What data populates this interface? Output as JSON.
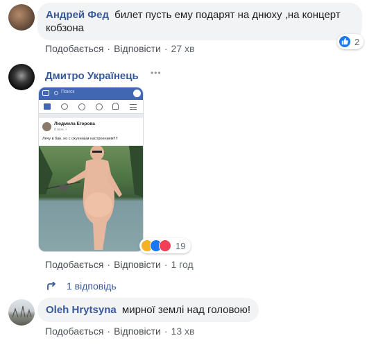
{
  "comments": [
    {
      "author": "Андрей Фед",
      "text": "билет пусть ему подарят на днюху ,на концерт кобзона",
      "actions": {
        "like": "Подобається",
        "reply": "Відповісти",
        "time": "27 хв"
      },
      "reactions": {
        "count": "2"
      }
    },
    {
      "author": "Дмитро Українець",
      "more_icon": "•••",
      "image": {
        "search_placeholder": "Поиск",
        "post_author": "Людмила Егорова",
        "post_meta": "8 июн. •",
        "post_text": "Лечу в бан, но с охуенным настроением!!!!"
      },
      "actions": {
        "like": "Подобається",
        "reply": "Відповісти",
        "time": "1 год"
      },
      "reactions": {
        "count": "19"
      },
      "replies_label": "1 відповідь"
    },
    {
      "author": "Oleh Hrytsyna",
      "text": "мирної землі над головою!",
      "actions": {
        "like": "Подобається",
        "reply": "Відповісти",
        "time": "13 хв"
      }
    }
  ],
  "colors": {
    "link": "#385898",
    "like_blue": "#1877f2",
    "love_red": "#f33e58",
    "haha_yellow": "#f7b125",
    "fb_blue": "#4267b2"
  }
}
